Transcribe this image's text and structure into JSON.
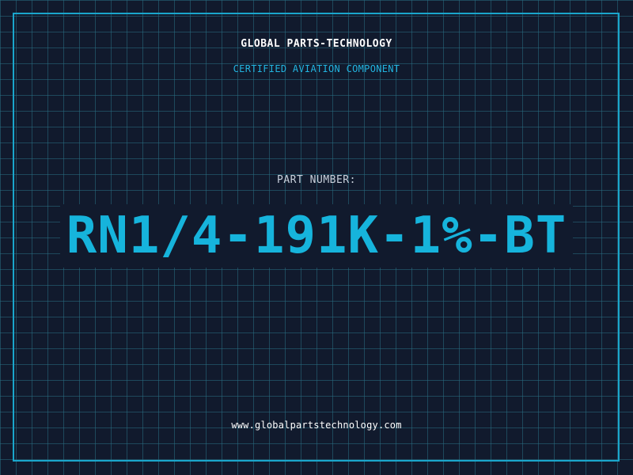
{
  "header": {
    "company": "GLOBAL PARTS-TECHNOLOGY",
    "subtitle": "CERTIFIED AVIATION COMPONENT"
  },
  "part": {
    "label": "PART NUMBER:",
    "number": "RN1/4-191K-1%-BT"
  },
  "footer": {
    "website": "www.globalpartstechnology.com"
  },
  "colors": {
    "background": "#111a2d",
    "grid": "#286e82",
    "accent": "#16b4dc",
    "text": "#ffffff"
  }
}
